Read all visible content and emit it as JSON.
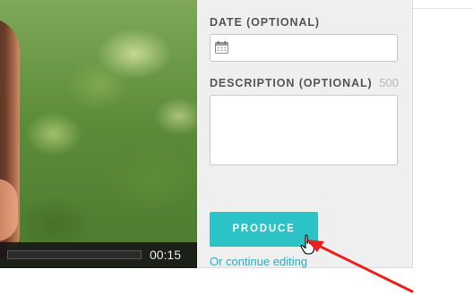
{
  "video": {
    "time": "00:15",
    "progress": 0
  },
  "form": {
    "date": {
      "label": "DATE (OPTIONAL)",
      "value": "",
      "icon": "calendar-icon"
    },
    "description": {
      "label": "DESCRIPTION (OPTIONAL)",
      "char_count": "500",
      "value": ""
    },
    "produce_label": "PRODUCE",
    "continue_link": "Or continue editing"
  },
  "colors": {
    "accent": "#2bc3c6",
    "link": "#2aaac8",
    "arrow": "#e8201e",
    "panel_bg": "#efefef"
  }
}
